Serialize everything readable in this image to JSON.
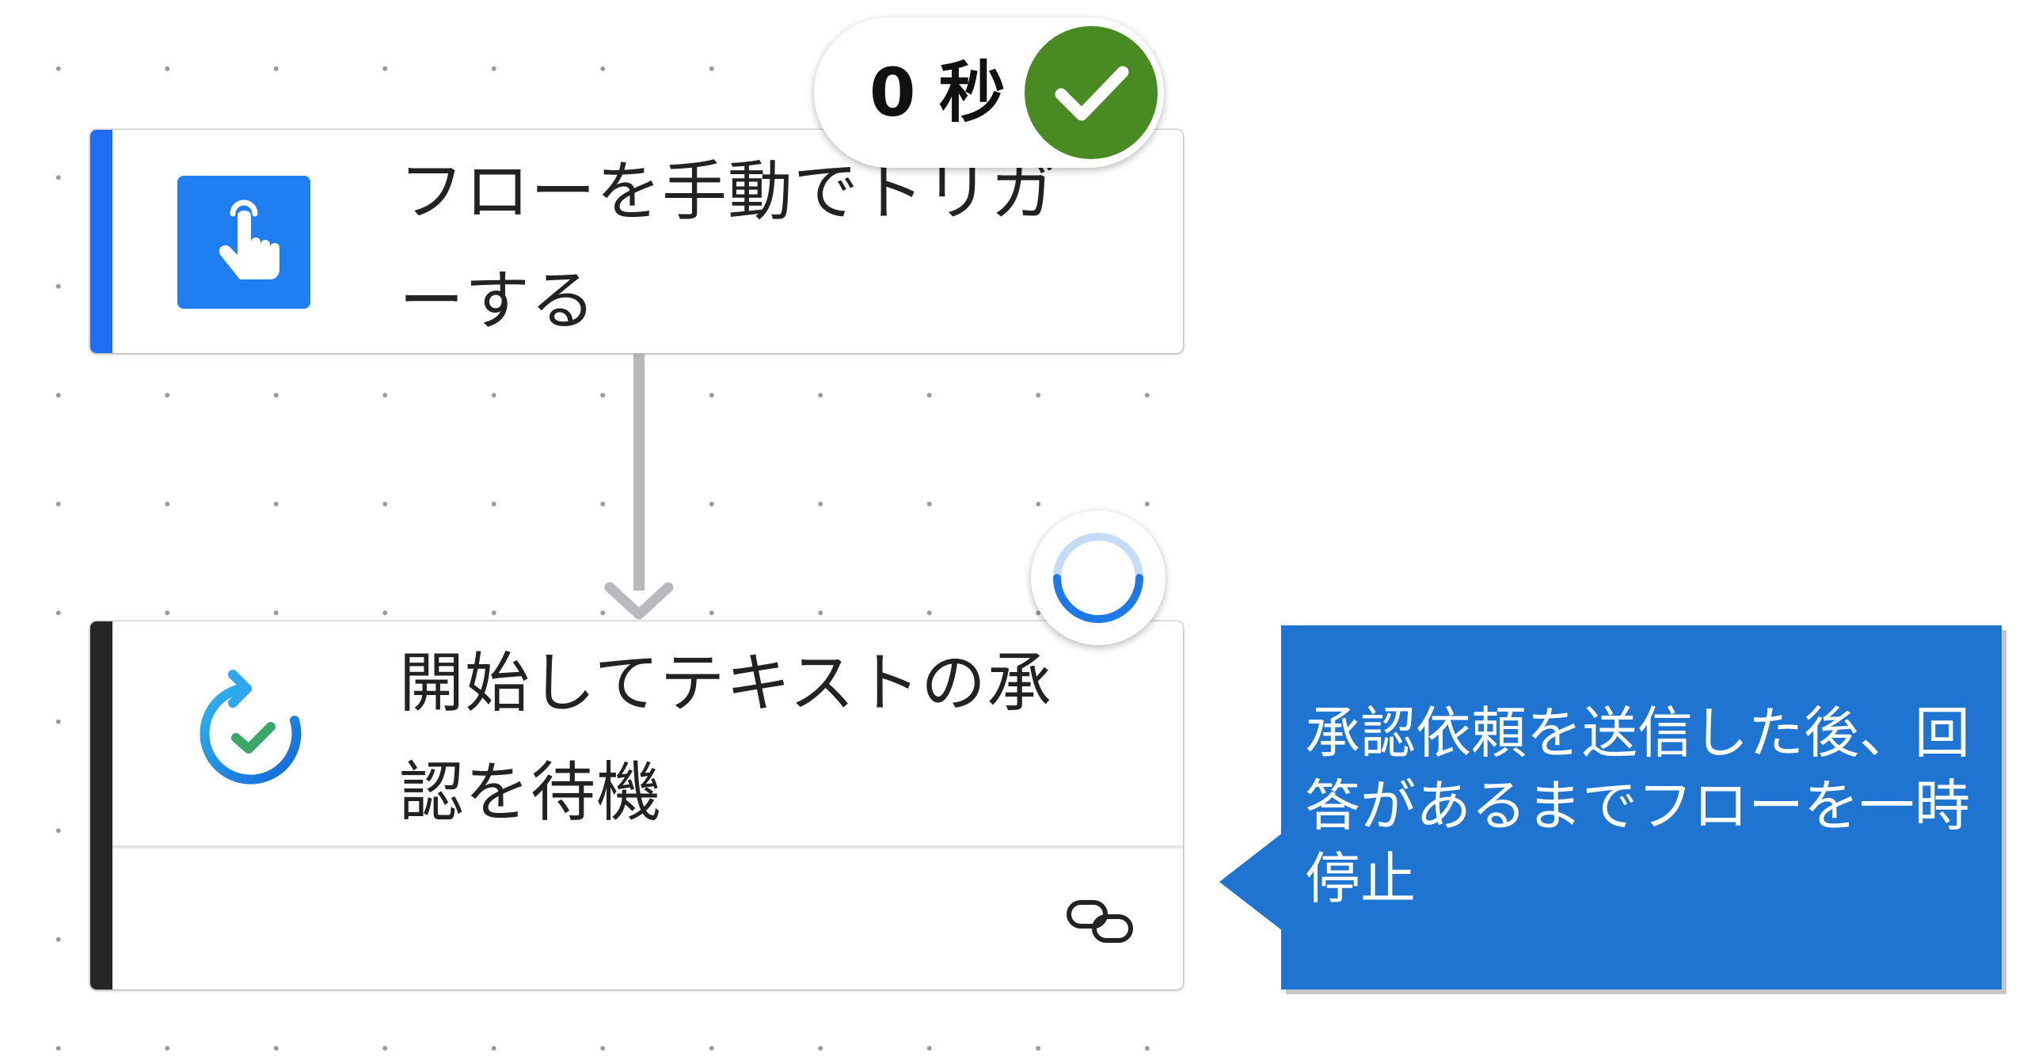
{
  "flow": {
    "trigger": {
      "title": "フローを手動でトリガーする",
      "icon": "touch-hand-icon",
      "accent_color": "#1f6ef2",
      "icon_bg_color": "#1f7ff0"
    },
    "trigger_status": {
      "duration": "0 秒",
      "state": "succeeded",
      "color": "#4a8a23"
    },
    "approval": {
      "title": "開始してテキストの承認を待機",
      "icon": "approval-cycle-check-icon",
      "accent_color": "#262626",
      "link_icon": "link-icon"
    },
    "approval_status": {
      "state": "running",
      "icon": "loading-spinner-icon"
    }
  },
  "callout": {
    "text": "承認依頼を送信した後、回答があるまでフローを一時停止",
    "bg_color": "#1f74d2"
  }
}
